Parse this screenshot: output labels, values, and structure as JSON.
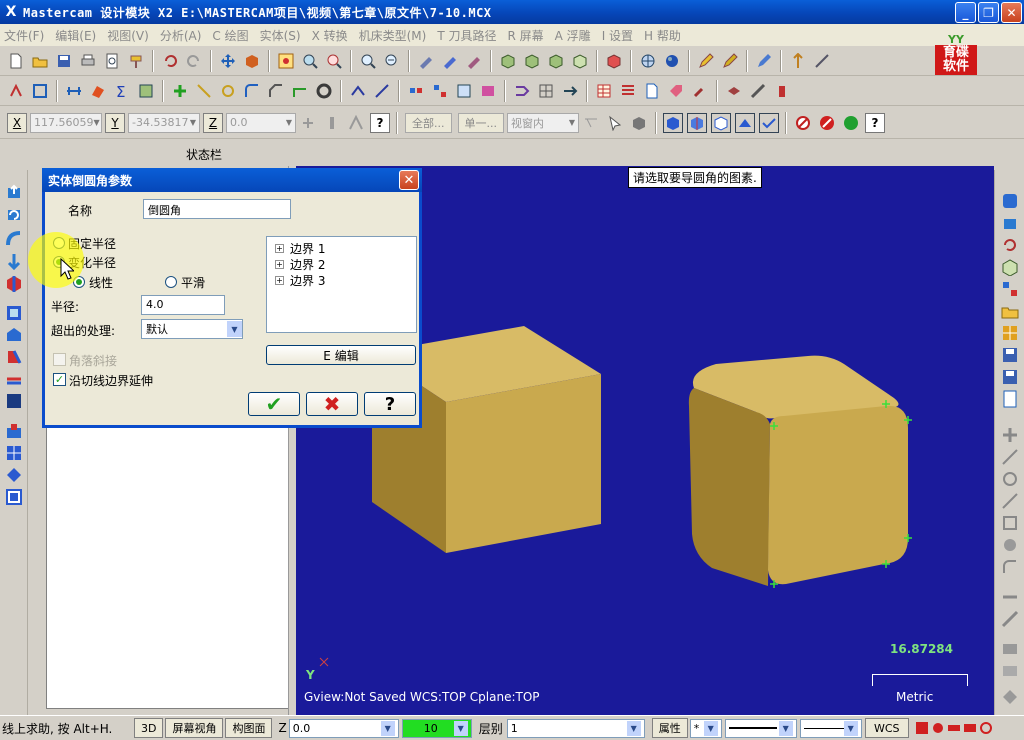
{
  "window": {
    "title": "Mastercam 设计模块  X2  E:\\MASTERCAM项目\\视频\\第七章\\原文件\\7-10.MCX",
    "minimize_glyph": "_",
    "maximize_glyph": "❐",
    "close_glyph": "✕",
    "app_icon_glyph": "X"
  },
  "menu": [
    "文件(F)",
    "编辑(E)",
    "视图(V)",
    "分析(A)",
    "C 绘图",
    "实体(S)",
    "X 转换",
    "机床类型(M)",
    "T 刀具路径",
    "R 屏幕",
    "A 浮雕",
    "I 设置",
    "H 帮助"
  ],
  "logo": {
    "top": "YY",
    "text": "育碟软件"
  },
  "coords": {
    "x_label": "X",
    "x_value": "117.56059",
    "y_label": "Y",
    "y_value": "-34.53817",
    "z_label": "Z",
    "z_value": "0.0",
    "btn_all": "全部...",
    "btn_single": "单一...",
    "view_mode": "视窗内"
  },
  "status_label": "状态栏",
  "viewport": {
    "prompt": "请选取要导圆角的图素.",
    "info": "Gview:Not Saved   WCS:TOP   Cplane:TOP",
    "scale_value": "16.87284",
    "scale_unit": "Metric",
    "axis_label": "Y",
    "colors": {
      "background": "#1a1a9a",
      "solid": "#c9a94e",
      "solid_dark": "#9e7f2e",
      "marker": "#3adf3a"
    }
  },
  "dialog": {
    "title": "实体倒圆角参数",
    "name_label": "名称",
    "name_value": "倒圆角",
    "radius_fixed": "固定半径",
    "radius_variable": "变化半径",
    "mode_linear": "线性",
    "mode_smooth": "平滑",
    "radius_label": "半径:",
    "radius_value": "4.0",
    "overflow_label": "超出的处理:",
    "overflow_value": "默认",
    "corner_blend": "角落斜接",
    "tangent_extend": "沿切线边界延伸",
    "tree_items": [
      "边界 1",
      "边界 2",
      "边界 3"
    ],
    "edit_button": "E 编辑",
    "ok_glyph": "✔",
    "cancel_glyph": "✖",
    "help_glyph": "?",
    "close_glyph": "✕"
  },
  "bottombar": {
    "hint": "线上求助, 按 Alt+H.",
    "btn_3d": "3D",
    "btn_screen_view": "屏幕视角",
    "btn_plane": "构图面",
    "z_label": "Z",
    "z_value": "0.0",
    "color_value": "10",
    "layer_label": "层别",
    "layer_value": "1",
    "attr_label": "属性",
    "wcs_label": "WCS"
  }
}
